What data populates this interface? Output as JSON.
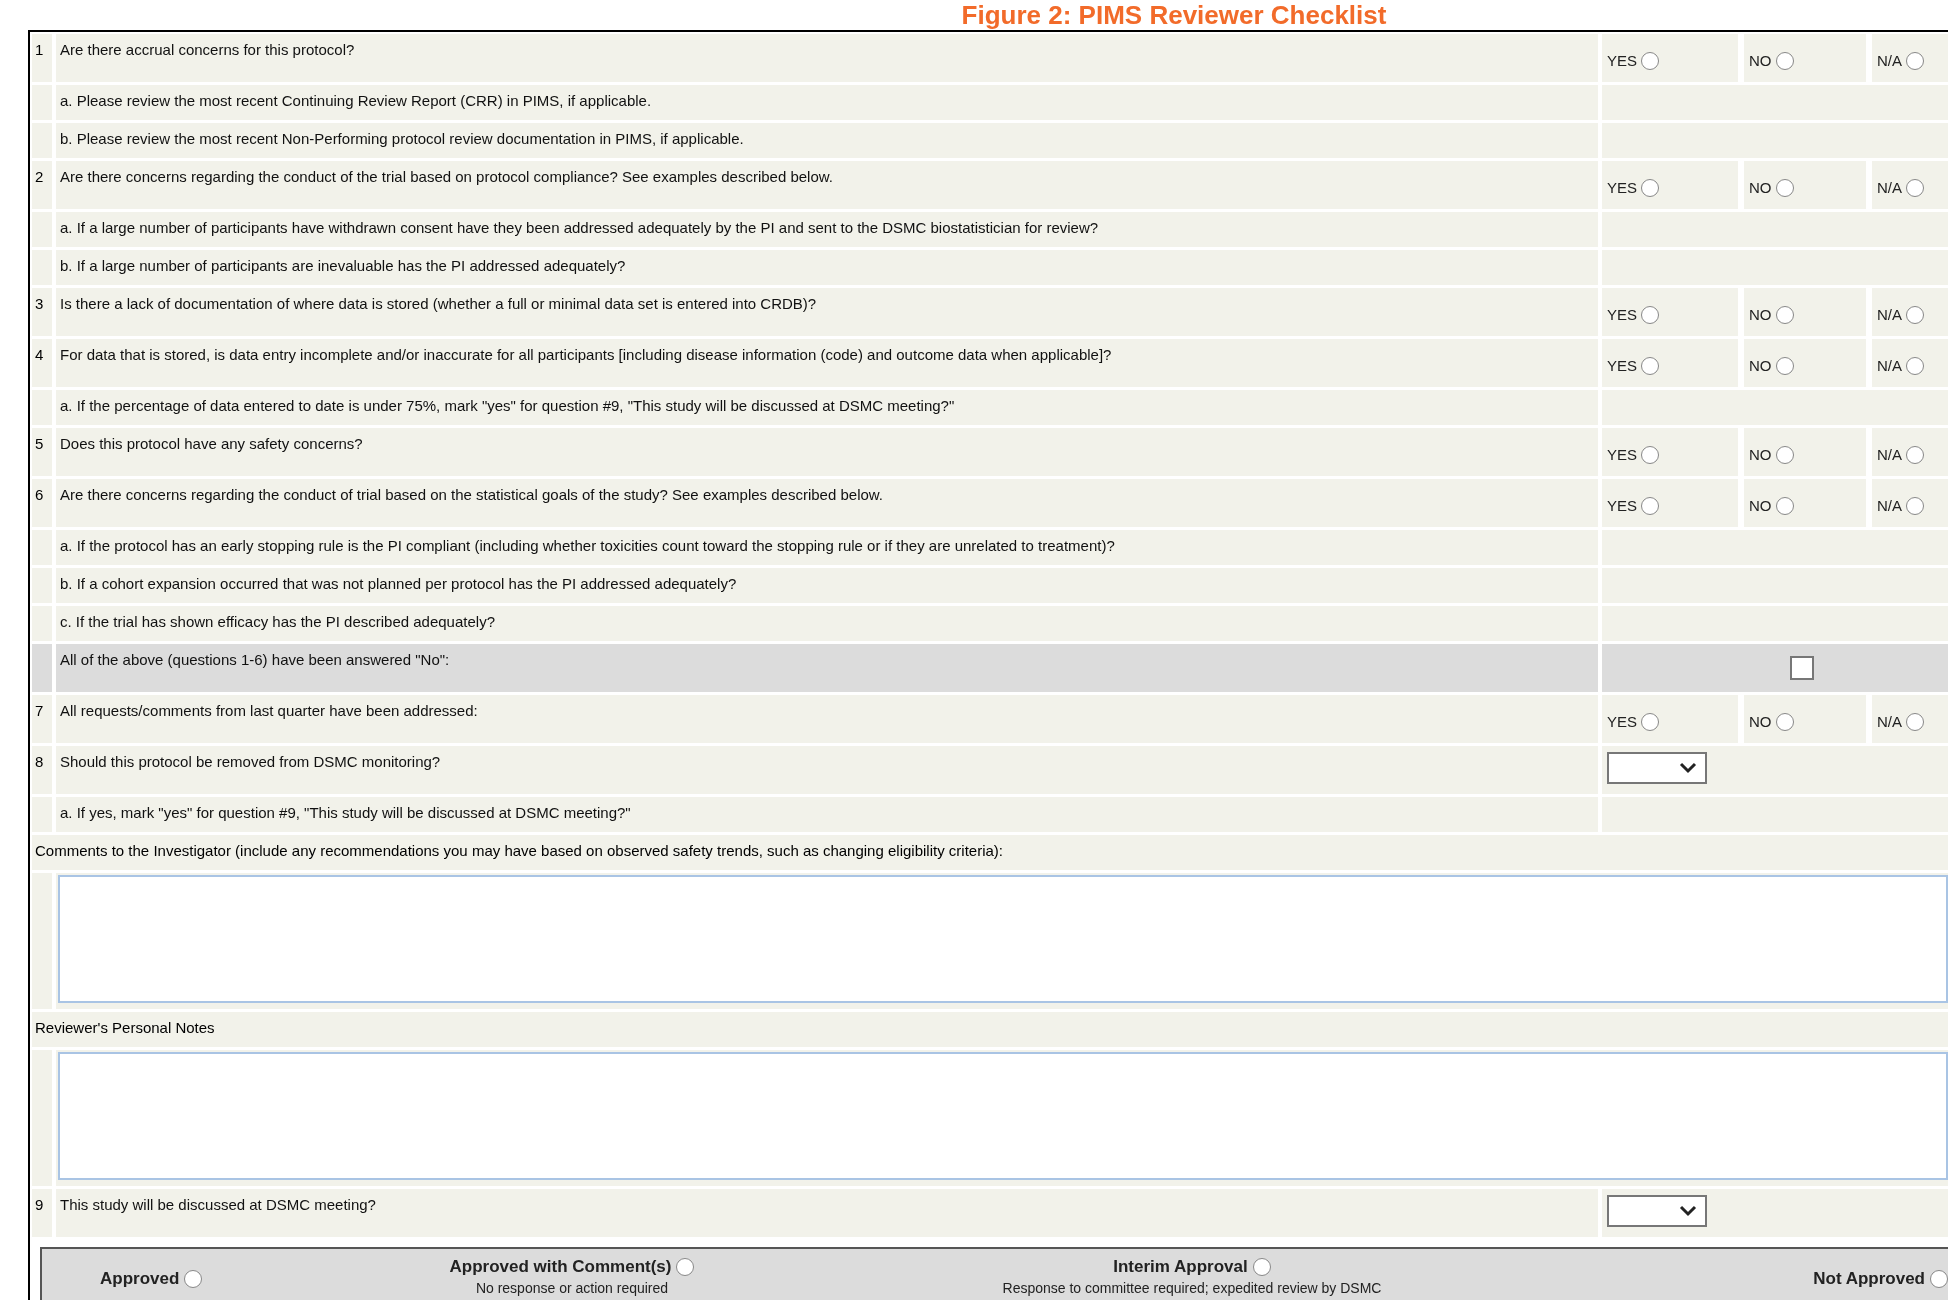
{
  "title": "Figure 2: PIMS Reviewer Checklist",
  "rows": [
    {
      "kind": "question",
      "number": "1",
      "text": "Are there accrual concerns for this protocol?",
      "options": [
        {
          "label": "YES",
          "selected": false
        },
        {
          "label": "NO",
          "selected": false
        },
        {
          "label": "N/A",
          "selected": false
        }
      ]
    },
    {
      "kind": "sub",
      "text": "a. Please review the most recent Continuing Review Report (CRR) in PIMS, if applicable."
    },
    {
      "kind": "sub",
      "text": "b. Please review the most recent Non-Performing protocol review documentation in PIMS, if applicable."
    },
    {
      "kind": "question",
      "number": "2",
      "text": "Are there concerns regarding the conduct of the trial based on protocol compliance? See examples described below.",
      "options": [
        {
          "label": "YES",
          "selected": false
        },
        {
          "label": "NO",
          "selected": false
        },
        {
          "label": "N/A",
          "selected": false
        }
      ]
    },
    {
      "kind": "sub",
      "text": "a. If a large number of participants have withdrawn consent have they been addressed adequately by the PI and sent to the DSMC biostatistician for review?"
    },
    {
      "kind": "sub",
      "text": "b. If a large number of participants are inevaluable has the PI addressed adequately?"
    },
    {
      "kind": "question",
      "number": "3",
      "text": "Is there a lack of documentation of where data is stored (whether a full or minimal data set is entered into CRDB)?",
      "options": [
        {
          "label": "YES",
          "selected": false
        },
        {
          "label": "NO",
          "selected": false
        },
        {
          "label": "N/A",
          "selected": false
        }
      ]
    },
    {
      "kind": "question",
      "number": "4",
      "text": "For data that is stored, is data entry incomplete and/or inaccurate for all participants [including disease information (code) and outcome data when applicable]?",
      "options": [
        {
          "label": "YES",
          "selected": false
        },
        {
          "label": "NO",
          "selected": false
        },
        {
          "label": "N/A",
          "selected": false
        }
      ]
    },
    {
      "kind": "sub",
      "text": "a. If the percentage of data entered to date is under 75%, mark \"yes\" for question #9, \"This study will be discussed at DSMC meeting?\""
    },
    {
      "kind": "question",
      "number": "5",
      "text": "Does this protocol have any safety concerns?",
      "options": [
        {
          "label": "YES",
          "selected": false
        },
        {
          "label": "NO",
          "selected": false
        },
        {
          "label": "N/A",
          "selected": false
        }
      ]
    },
    {
      "kind": "question",
      "number": "6",
      "text": "Are there concerns regarding the conduct of trial based on the statistical goals of the study? See examples described below.",
      "options": [
        {
          "label": "YES",
          "selected": false
        },
        {
          "label": "NO",
          "selected": false
        },
        {
          "label": "N/A",
          "selected": false
        }
      ]
    },
    {
      "kind": "sub",
      "text": "a. If the protocol has an early stopping rule is the PI compliant (including whether toxicities count toward the stopping rule or if they are unrelated to treatment)?"
    },
    {
      "kind": "sub",
      "text": "b. If a cohort expansion occurred that was not planned per protocol has the PI addressed adequately?"
    },
    {
      "kind": "sub",
      "text": "c. If the trial has shown efficacy has the PI described adequately?"
    },
    {
      "kind": "check",
      "text": "All of the above (questions 1-6) have been answered \"No\":",
      "checked": false
    },
    {
      "kind": "question",
      "number": "7",
      "text": "All requests/comments from last quarter have been addressed:",
      "options": [
        {
          "label": "YES",
          "selected": false
        },
        {
          "label": "NO",
          "selected": false
        },
        {
          "label": "N/A",
          "selected": false
        }
      ]
    },
    {
      "kind": "select",
      "number": "8",
      "text": "Should this protocol be removed from DSMC monitoring?"
    },
    {
      "kind": "sub",
      "text": "a. If yes, mark \"yes\" for question #9, \"This study will be discussed at DSMC meeting?\""
    },
    {
      "kind": "label",
      "text": "Comments to the Investigator (include any recommendations you may have based on observed safety trends, such as changing eligibility criteria):"
    },
    {
      "kind": "textarea"
    },
    {
      "kind": "label",
      "text": "Reviewer's Personal Notes"
    },
    {
      "kind": "textarea"
    },
    {
      "kind": "select",
      "number": "9",
      "text": "This study will be discussed at DSMC meeting?"
    }
  ],
  "approvals": [
    {
      "label": "Approved",
      "selected": false
    },
    {
      "label": "Approved with Comment(s)",
      "note": "No response or action required",
      "selected": false
    },
    {
      "label": "Interim Approval",
      "note": "Response to committee required; expedited review by DSMC",
      "selected": false
    },
    {
      "label": "Not Approved",
      "selected": false
    }
  ]
}
